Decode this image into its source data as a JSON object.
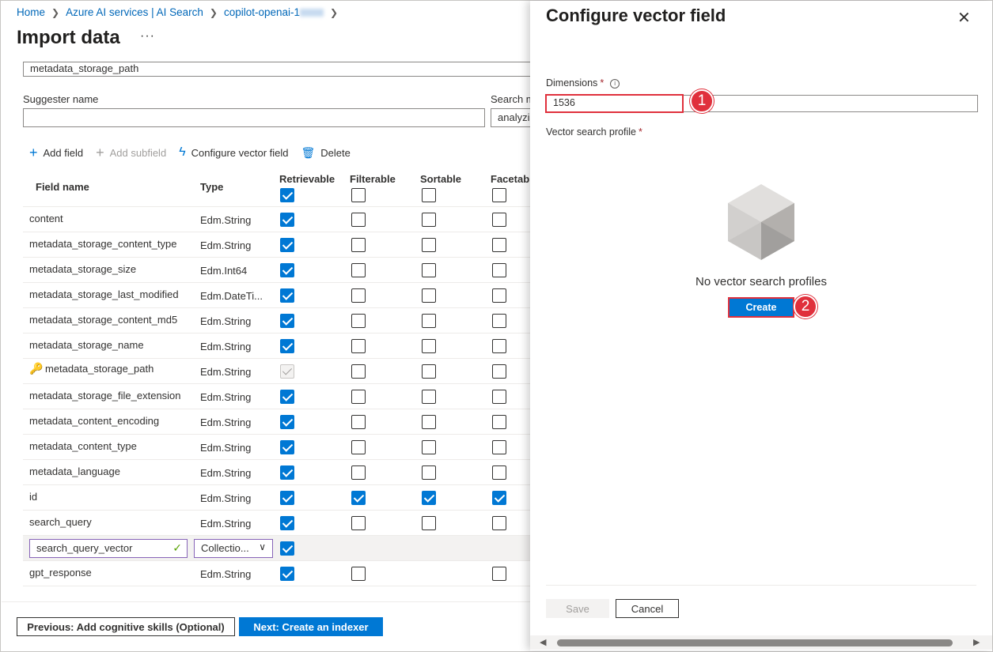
{
  "breadcrumb": {
    "items": [
      "Home",
      "Azure AI services | AI Search",
      "copilot-openai-1"
    ]
  },
  "page": {
    "title": "Import data",
    "more": "···"
  },
  "form": {
    "partial_field_value": "metadata_storage_path",
    "suggester_label": "Suggester name",
    "suggester_value": "",
    "search_mode_label": "Search m",
    "search_mode_value": "analyzi"
  },
  "toolbar": {
    "add_field": "Add field",
    "add_subfield": "Add subfield",
    "configure_vector": "Configure vector field",
    "delete": "Delete"
  },
  "table": {
    "columns": [
      "Field name",
      "Type",
      "Retrievable",
      "Filterable",
      "Sortable",
      "Facetable"
    ],
    "header_checks": {
      "retrievable": true,
      "filterable": false,
      "sortable": false,
      "facetable": false
    },
    "rows": [
      {
        "name": "content",
        "type": "Edm.String",
        "retrievable": "on",
        "filterable": "off",
        "sortable": "off",
        "facetable": "off"
      },
      {
        "name": "metadata_storage_content_type",
        "type": "Edm.String",
        "retrievable": "on",
        "filterable": "off",
        "sortable": "off",
        "facetable": "off"
      },
      {
        "name": "metadata_storage_size",
        "type": "Edm.Int64",
        "retrievable": "on",
        "filterable": "off",
        "sortable": "off",
        "facetable": "off"
      },
      {
        "name": "metadata_storage_last_modified",
        "type": "Edm.DateTi...",
        "retrievable": "on",
        "filterable": "off",
        "sortable": "off",
        "facetable": "off"
      },
      {
        "name": "metadata_storage_content_md5",
        "type": "Edm.String",
        "retrievable": "on",
        "filterable": "off",
        "sortable": "off",
        "facetable": "off"
      },
      {
        "name": "metadata_storage_name",
        "type": "Edm.String",
        "retrievable": "on",
        "filterable": "off",
        "sortable": "off",
        "facetable": "off"
      },
      {
        "name": "metadata_storage_path",
        "type": "Edm.String",
        "retrievable": "disabled",
        "filterable": "off",
        "sortable": "off",
        "facetable": "off",
        "key": true
      },
      {
        "name": "metadata_storage_file_extension",
        "type": "Edm.String",
        "retrievable": "on",
        "filterable": "off",
        "sortable": "off",
        "facetable": "off"
      },
      {
        "name": "metadata_content_encoding",
        "type": "Edm.String",
        "retrievable": "on",
        "filterable": "off",
        "sortable": "off",
        "facetable": "off"
      },
      {
        "name": "metadata_content_type",
        "type": "Edm.String",
        "retrievable": "on",
        "filterable": "off",
        "sortable": "off",
        "facetable": "off"
      },
      {
        "name": "metadata_language",
        "type": "Edm.String",
        "retrievable": "on",
        "filterable": "off",
        "sortable": "off",
        "facetable": "off"
      },
      {
        "name": "id",
        "type": "Edm.String",
        "retrievable": "on",
        "filterable": "on",
        "sortable": "on",
        "facetable": "on"
      },
      {
        "name": "search_query",
        "type": "Edm.String",
        "retrievable": "on",
        "filterable": "off",
        "sortable": "off",
        "facetable": "off"
      },
      {
        "name": "search_query_vector",
        "type": "Collectio...",
        "retrievable": "on",
        "filterable": "none",
        "sortable": "none",
        "facetable": "none",
        "editing": true
      },
      {
        "name": "gpt_response",
        "type": "Edm.String",
        "retrievable": "on",
        "filterable": "off",
        "sortable": "none",
        "facetable": "off"
      }
    ]
  },
  "footer": {
    "previous": "Previous: Add cognitive skills (Optional)",
    "next": "Next: Create an indexer"
  },
  "panel": {
    "title": "Configure vector field",
    "close_icon": "close-icon",
    "dimensions_label": "Dimensions",
    "required_mark": "*",
    "dimensions_value": "1536",
    "profile_label": "Vector search profile",
    "empty_text": "No vector search profiles",
    "create": "Create",
    "save": "Save",
    "cancel": "Cancel",
    "annotation_1": "1",
    "annotation_2": "2"
  },
  "colors": {
    "accent": "#0078d4",
    "link": "#0067b8",
    "highlight": "#e0303c",
    "edit_border": "#8764b8",
    "valid_check": "#57a300"
  }
}
